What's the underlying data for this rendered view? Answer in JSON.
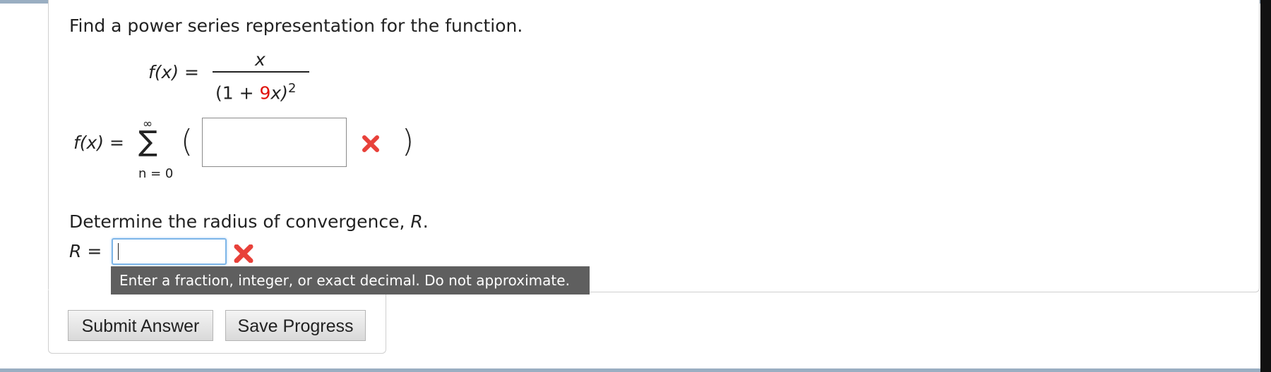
{
  "question": {
    "prompt": "Find a power series representation for the function.",
    "function_label": "f(x) =",
    "numerator": "x",
    "denominator_open": "(1 + ",
    "denominator_coef": "9",
    "denominator_var": "x)",
    "denominator_exp": "2",
    "series_label": "f(x) =",
    "sum_upper": "∞",
    "sum_symbol": "∑",
    "sum_lower": "n = 0",
    "paren_open": "(",
    "paren_close": ")",
    "series_value": "",
    "radius_prompt": "Determine the radius of convergence, R.",
    "r_label": "R =",
    "r_value": "",
    "tooltip": "Enter a fraction, integer, or exact decimal. Do not approximate."
  },
  "buttons": {
    "submit": "Submit Answer",
    "save": "Save Progress"
  },
  "icons": {
    "incorrect": "x-mark-icon",
    "incorrect_color": "#e8413a"
  }
}
